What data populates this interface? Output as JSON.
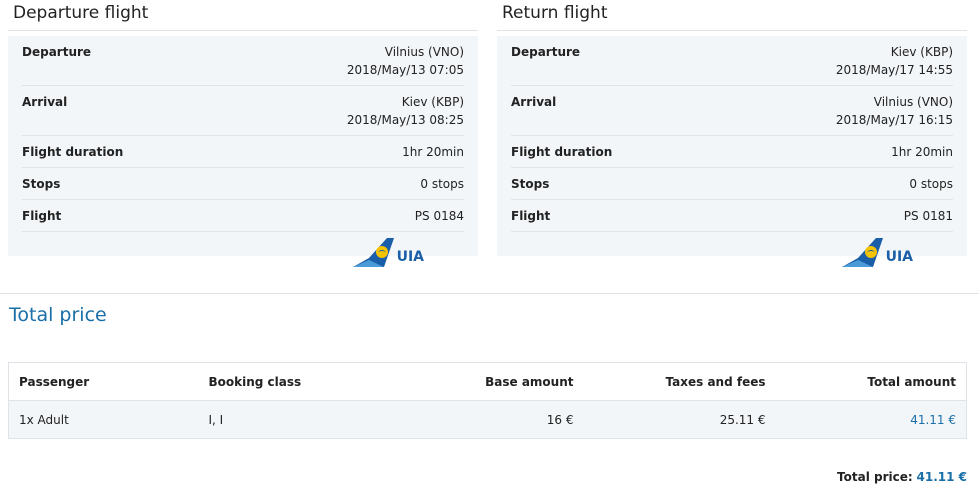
{
  "departure": {
    "title": "Departure flight",
    "rows": [
      {
        "label": "Departure",
        "line1": "Vilnius (VNO)",
        "line2": "2018/May/13 07:05"
      },
      {
        "label": "Arrival",
        "line1": "Kiev (KBP)",
        "line2": "2018/May/13 08:25"
      },
      {
        "label": "Flight duration",
        "line1": "1hr 20min"
      },
      {
        "label": "Stops",
        "line1": "0 stops"
      },
      {
        "label": "Flight",
        "line1": "PS 0184"
      }
    ],
    "airline_logo": "UIA"
  },
  "return": {
    "title": "Return flight",
    "rows": [
      {
        "label": "Departure",
        "line1": "Kiev (KBP)",
        "line2": "2018/May/17 14:55"
      },
      {
        "label": "Arrival",
        "line1": "Vilnius (VNO)",
        "line2": "2018/May/17 16:15"
      },
      {
        "label": "Flight duration",
        "line1": "1hr 20min"
      },
      {
        "label": "Stops",
        "line1": "0 stops"
      },
      {
        "label": "Flight",
        "line1": "PS 0181"
      }
    ],
    "airline_logo": "UIA"
  },
  "total": {
    "title": "Total price",
    "headers": [
      "Passenger",
      "Booking class",
      "Base amount",
      "Taxes and fees",
      "Total amount"
    ],
    "row": {
      "passenger": "1x Adult",
      "booking_class": "I, I",
      "base": "16 €",
      "taxes": "25.11 €",
      "total": "41.11 €"
    },
    "total_label": "Total price:",
    "total_value": "41.11 €"
  },
  "colors": {
    "accent": "#1a6fa8",
    "panel_bg": "#f3f6f9",
    "logo_blue": "#1a5ea8",
    "logo_yellow": "#f5c400"
  }
}
